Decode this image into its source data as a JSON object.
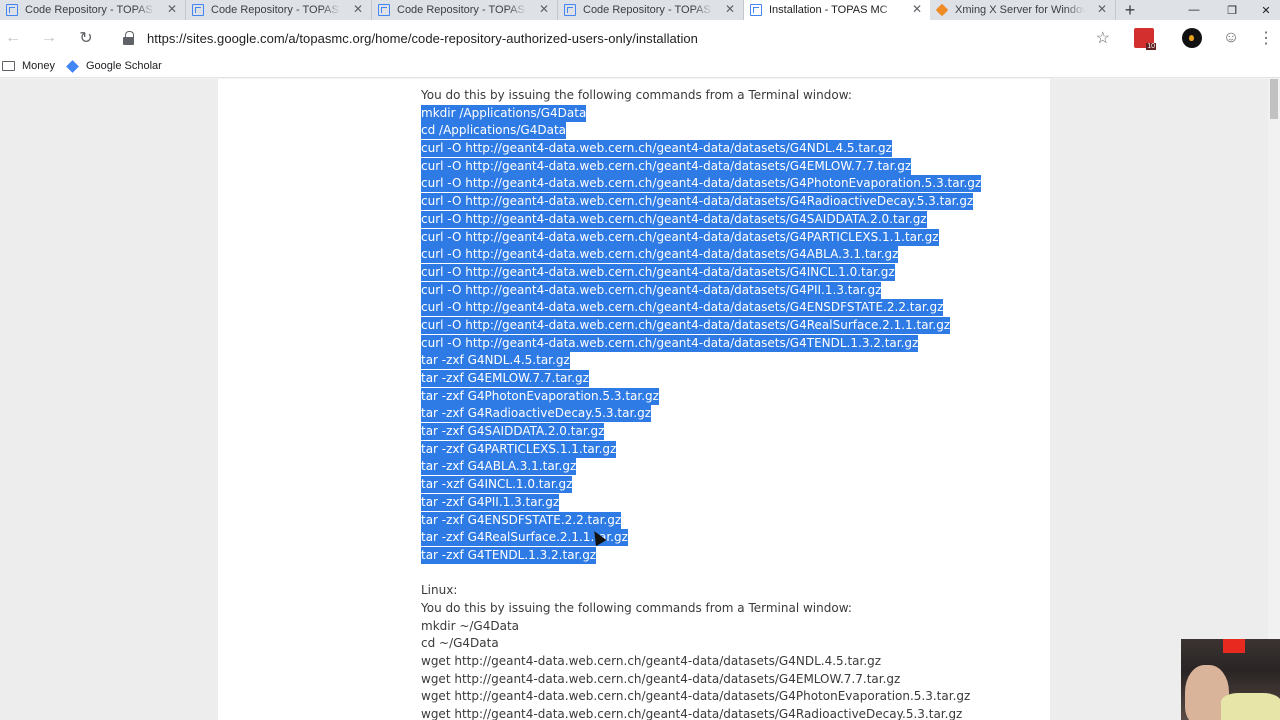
{
  "tabs": [
    {
      "title": "Code Repository - TOPAS MC",
      "active": false,
      "icon": "google-sites-icon"
    },
    {
      "title": "Code Repository - TOPAS MC",
      "active": false,
      "icon": "google-sites-icon"
    },
    {
      "title": "Code Repository - TOPAS MC",
      "active": false,
      "icon": "google-sites-icon"
    },
    {
      "title": "Code Repository - TOPAS MC",
      "active": false,
      "icon": "google-sites-icon"
    },
    {
      "title": "Installation - TOPAS MC",
      "active": true,
      "icon": "google-sites-icon"
    },
    {
      "title": "Xming X Server for Windows",
      "active": false,
      "icon": "xming-icon"
    }
  ],
  "window_controls": {
    "minimize": "—",
    "restore": "❐",
    "close": "✕"
  },
  "address_bar": {
    "url": "https://sites.google.com/a/topasmc.org/home/code-repository-authorized-users-only/installation"
  },
  "extensions": {
    "pdf_badge": "10"
  },
  "bookmarks": [
    {
      "label": "Money",
      "icon": "folder-icon"
    },
    {
      "label": "Google Scholar",
      "icon": "google-scholar-icon"
    }
  ],
  "content": {
    "intro_mac": "You do this by issuing the following commands from a Terminal window:",
    "mac_commands": [
      "mkdir /Applications/G4Data",
      "cd /Applications/G4Data",
      "curl -O http://geant4-data.web.cern.ch/geant4-data/datasets/G4NDL.4.5.tar.gz",
      "curl -O http://geant4-data.web.cern.ch/geant4-data/datasets/G4EMLOW.7.7.tar.gz",
      "curl -O http://geant4-data.web.cern.ch/geant4-data/datasets/G4PhotonEvaporation.5.3.tar.gz",
      "curl -O http://geant4-data.web.cern.ch/geant4-data/datasets/G4RadioactiveDecay.5.3.tar.gz",
      "curl -O http://geant4-data.web.cern.ch/geant4-data/datasets/G4SAIDDATA.2.0.tar.gz",
      "curl -O http://geant4-data.web.cern.ch/geant4-data/datasets/G4PARTICLEXS.1.1.tar.gz",
      "curl -O http://geant4-data.web.cern.ch/geant4-data/datasets/G4ABLA.3.1.tar.gz",
      "curl -O http://geant4-data.web.cern.ch/geant4-data/datasets/G4INCL.1.0.tar.gz",
      "curl -O http://geant4-data.web.cern.ch/geant4-data/datasets/G4PII.1.3.tar.gz",
      "curl -O http://geant4-data.web.cern.ch/geant4-data/datasets/G4ENSDFSTATE.2.2.tar.gz",
      "curl -O http://geant4-data.web.cern.ch/geant4-data/datasets/G4RealSurface.2.1.1.tar.gz",
      "curl -O http://geant4-data.web.cern.ch/geant4-data/datasets/G4TENDL.1.3.2.tar.gz",
      "tar -zxf G4NDL.4.5.tar.gz",
      "tar -zxf G4EMLOW.7.7.tar.gz",
      "tar -zxf G4PhotonEvaporation.5.3.tar.gz",
      "tar -zxf G4RadioactiveDecay.5.3.tar.gz",
      "tar -zxf G4SAIDDATA.2.0.tar.gz",
      "tar -zxf G4PARTICLEXS.1.1.tar.gz",
      "tar -zxf G4ABLA.3.1.tar.gz",
      "tar -xzf G4INCL.1.0.tar.gz",
      "tar -zxf G4PII.1.3.tar.gz",
      "tar -zxf G4ENSDFSTATE.2.2.tar.gz",
      "tar -zxf G4RealSurface.2.1.1.tar.gz",
      "tar -zxf G4TENDL.1.3.2.tar.gz"
    ],
    "linux_heading": "Linux:",
    "intro_linux": "You do this by issuing the following commands from a Terminal window:",
    "linux_commands": [
      "mkdir ~/G4Data",
      "cd ~/G4Data",
      "wget http://geant4-data.web.cern.ch/geant4-data/datasets/G4NDL.4.5.tar.gz",
      "wget http://geant4-data.web.cern.ch/geant4-data/datasets/G4EMLOW.7.7.tar.gz",
      "wget http://geant4-data.web.cern.ch/geant4-data/datasets/G4PhotonEvaporation.5.3.tar.gz",
      "wget http://geant4-data.web.cern.ch/geant4-data/datasets/G4RadioactiveDecay.5.3.tar.gz"
    ]
  },
  "colors": {
    "selection": "#2f7be6",
    "text": "#3a3a3a",
    "tab_strip": "#dee1e6"
  }
}
